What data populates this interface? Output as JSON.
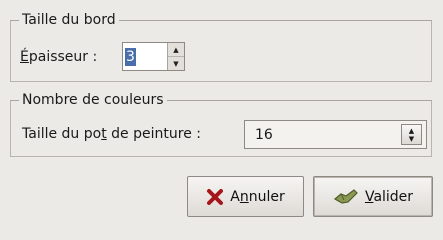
{
  "border_group": {
    "legend": "Taille du bord",
    "thickness_label_mnemonic": "É",
    "thickness_label_rest": "paisseur :",
    "thickness_value": "3"
  },
  "colors_group": {
    "legend": "Nombre de couleurs",
    "pot_label_before": "Taille du po",
    "pot_label_mnemonic": "t",
    "pot_label_after": " de peinture :",
    "pot_value": "16"
  },
  "buttons": {
    "cancel_before": "A",
    "cancel_mnemonic": "n",
    "cancel_after": "nuler",
    "ok_mnemonic": "V",
    "ok_after": "alider"
  },
  "icons": {
    "cancel": "x-icon",
    "ok": "check-hand-icon",
    "cancel_color": "#a4161a",
    "ok_color": "#6c7f3a"
  }
}
